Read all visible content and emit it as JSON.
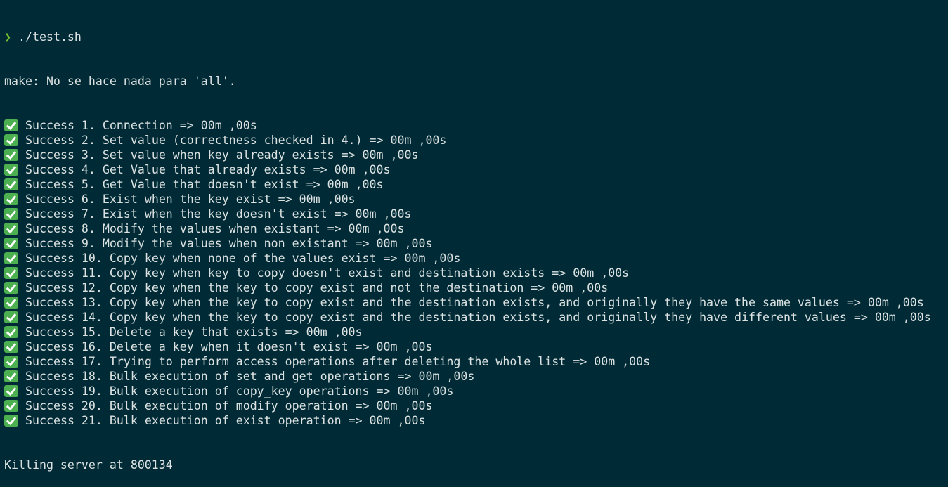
{
  "prompt": {
    "arrow": "❯",
    "command": "./test.sh"
  },
  "make_output": "make: No se hace nada para 'all'.",
  "results": [
    "Success 1. Connection => 00m ,00s",
    "Success 2. Set value (correctness checked in 4.) => 00m ,00s",
    "Success 3. Set value when key already exists => 00m ,00s",
    "Success 4. Get Value that already exists => 00m ,00s",
    "Success 5. Get Value that doesn't exist => 00m ,00s",
    "Success 6. Exist when the key exist => 00m ,00s",
    "Success 7. Exist when the key doesn't exist => 00m ,00s",
    "Success 8. Modify the values when existant => 00m ,00s",
    "Success 9. Modify the values when non existant => 00m ,00s",
    "Success 10. Copy key when none of the values exist => 00m ,00s",
    "Success 11. Copy key when key to copy doesn't exist and destination exists => 00m ,00s",
    "Success 12. Copy key when the key to copy exist and not the destination => 00m ,00s",
    "Success 13. Copy key when the key to copy exist and the destination exists, and originally they have the same values => 00m ,00s",
    "Success 14. Copy key when the key to copy exist and the destination exists, and originally they have different values => 00m ,00s",
    "Success 15. Delete a key that exists => 00m ,00s",
    "Success 16. Delete a key when it doesn't exist => 00m ,00s",
    "Success 17. Trying to perform access operations after deleting the whole list => 00m ,00s",
    "Success 18. Bulk execution of set and get operations => 00m ,00s",
    "Success 19. Bulk execution of copy_key operations => 00m ,00s",
    "Success 20. Bulk execution of modify operation => 00m ,00s",
    "Success 21. Bulk execution of exist operation => 00m ,00s"
  ],
  "status_icon": "check-mark-icon",
  "footer": "Killing server at 800134",
  "colors": {
    "background": "#002b36",
    "text": "#dce2e2",
    "prompt": "#74c22b",
    "check": "#4caf50"
  }
}
